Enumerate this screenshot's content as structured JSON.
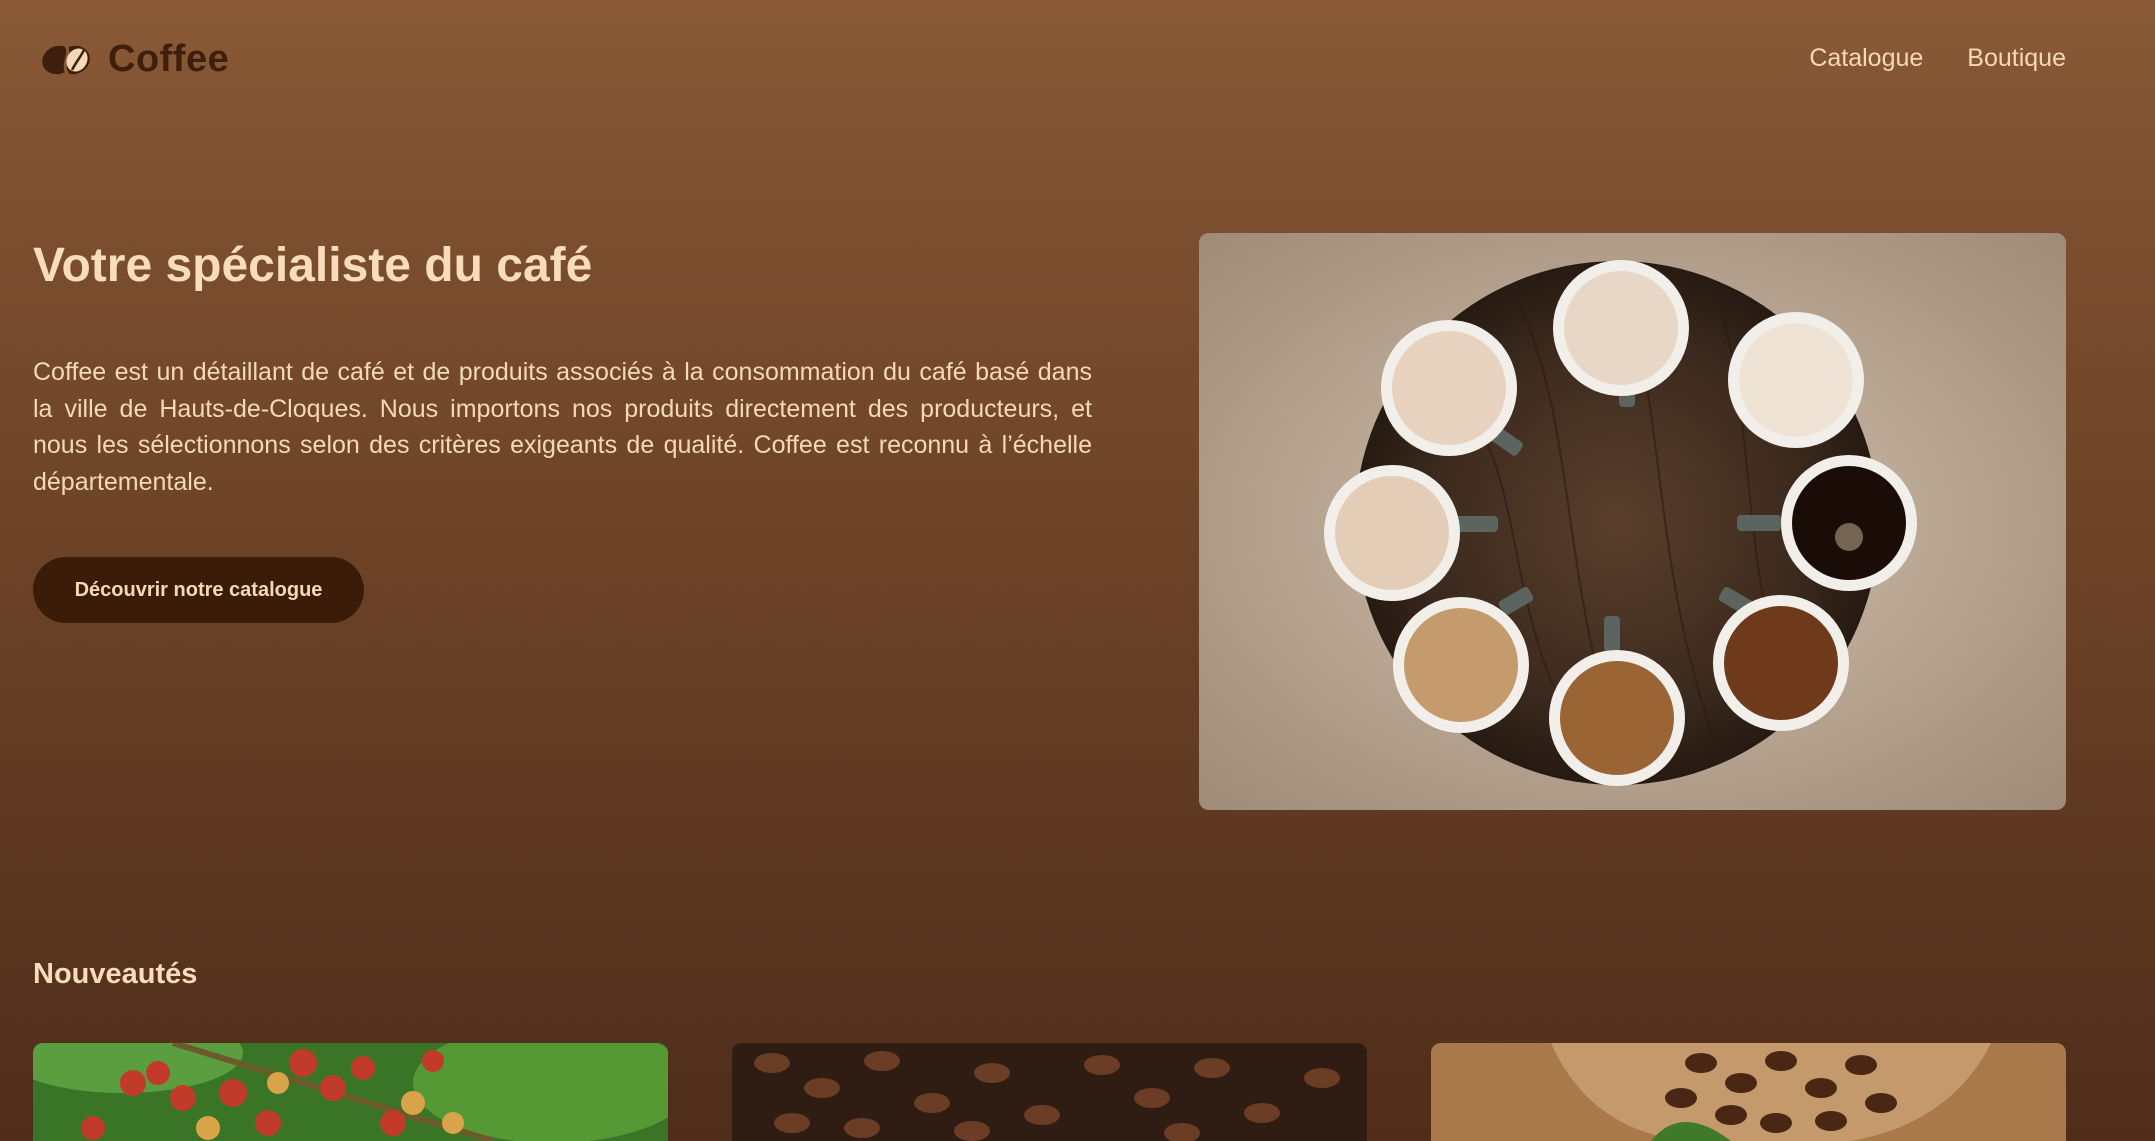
{
  "header": {
    "brand": "Coffee",
    "logo_icon": "coffee-bean-icon",
    "nav": [
      {
        "label": "Catalogue"
      },
      {
        "label": "Boutique"
      }
    ]
  },
  "hero": {
    "title": "Votre spécialiste du café",
    "description": "Coffee est un détaillant de café et de produits associés à la consommation du café basé dans la ville de Hauts-de-Cloques. Nous importons nos produits directement des producteurs, et nous les sélectionnons selon des critères exigeants de qualité. Coffee est reconnu à l’échelle départementale.",
    "cta_label": "Découvrir notre catalogue"
  },
  "new_items": {
    "title": "Nouveautés"
  },
  "colors": {
    "background_top": "#8a5a37",
    "background_bottom": "#4f2d1a",
    "text": "#f4d9b8",
    "button": "#3a1c08",
    "brand": "#3e1f0c"
  }
}
